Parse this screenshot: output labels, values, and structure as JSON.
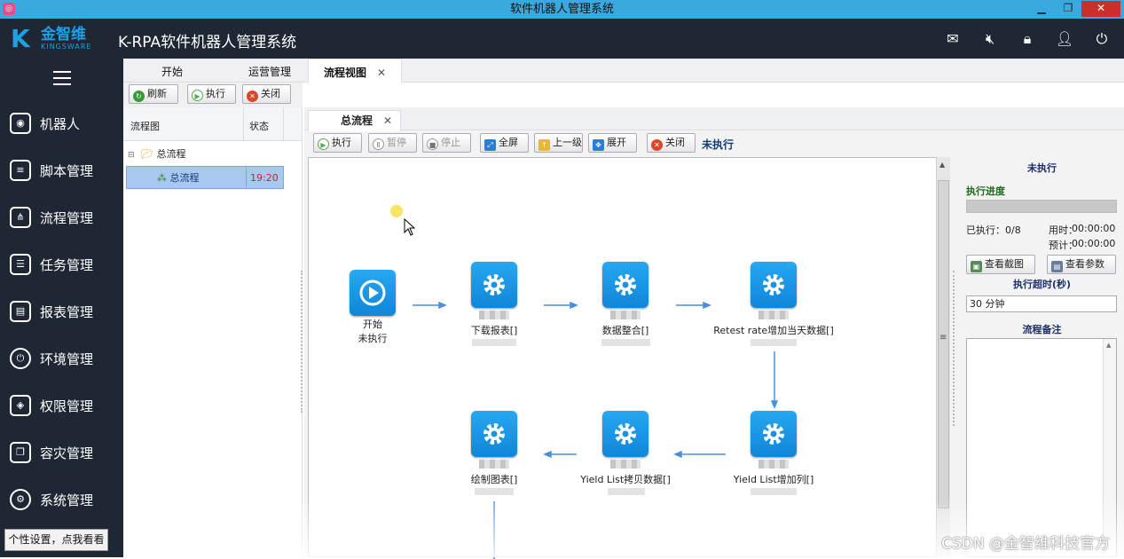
{
  "window": {
    "title": "软件机器人管理系统",
    "min": "▁",
    "max": "❐",
    "close": "✕"
  },
  "header": {
    "logo_k": "K",
    "logo_cn": "金智维",
    "logo_en": "KINGSWARE",
    "system_title": "K-RPA软件机器人管理系统"
  },
  "sidebar": {
    "items": [
      {
        "label": "机器人",
        "icon": "robot-icon"
      },
      {
        "label": "脚本管理",
        "icon": "script-icon"
      },
      {
        "label": "流程管理",
        "icon": "flow-icon"
      },
      {
        "label": "任务管理",
        "icon": "task-icon"
      },
      {
        "label": "报表管理",
        "icon": "report-icon"
      },
      {
        "label": "环境管理",
        "icon": "environment-icon"
      },
      {
        "label": "权限管理",
        "icon": "permission-icon"
      },
      {
        "label": "容灾管理",
        "icon": "disaster-recovery-icon"
      },
      {
        "label": "系统管理",
        "icon": "settings-icon"
      }
    ],
    "tooltip": "个性设置，点我看看"
  },
  "tabs": [
    {
      "label": "开始"
    },
    {
      "label": "运营管理"
    },
    {
      "label": "流程视图",
      "close": "✕"
    }
  ],
  "toolbar1": {
    "refresh": "刷新",
    "run": "执行",
    "close": "关闭"
  },
  "tree": {
    "col_flowchart": "流程图",
    "col_status": "状态",
    "root": "总流程",
    "child": "总流程",
    "child_time": "19:20"
  },
  "subtab": {
    "label": "总流程",
    "close": "✕"
  },
  "toolbar2": {
    "run": "执行",
    "pause": "暂停",
    "stop": "停止",
    "fullscreen": "全屏",
    "up": "上一级",
    "expand": "展开",
    "close": "关闭",
    "status": "未执行"
  },
  "flow": {
    "start": {
      "label": "开始",
      "state": "未执行"
    },
    "nodes": [
      {
        "label": "下载报表[]"
      },
      {
        "label": "数据整合[]"
      },
      {
        "label": "Retest rate增加当天数据[]"
      },
      {
        "label": "Yield List增加列[]"
      },
      {
        "label": "Yield List拷贝数据[]"
      },
      {
        "label": "绘制图表[]"
      }
    ]
  },
  "info": {
    "status": "未执行",
    "progress_label": "执行进度",
    "progress": 0,
    "executed": "已执行：0/8",
    "used_label": "用时：",
    "used": "00:00:00",
    "est_label": "预计：",
    "est": "00:00:00",
    "view_screenshot": "查看截图",
    "view_params": "查看参数",
    "timeout_label": "执行超时(秒)",
    "timeout_value": "30 分钟",
    "notes_label": "流程备注"
  },
  "watermark": "CSDN @金智维科技官方"
}
